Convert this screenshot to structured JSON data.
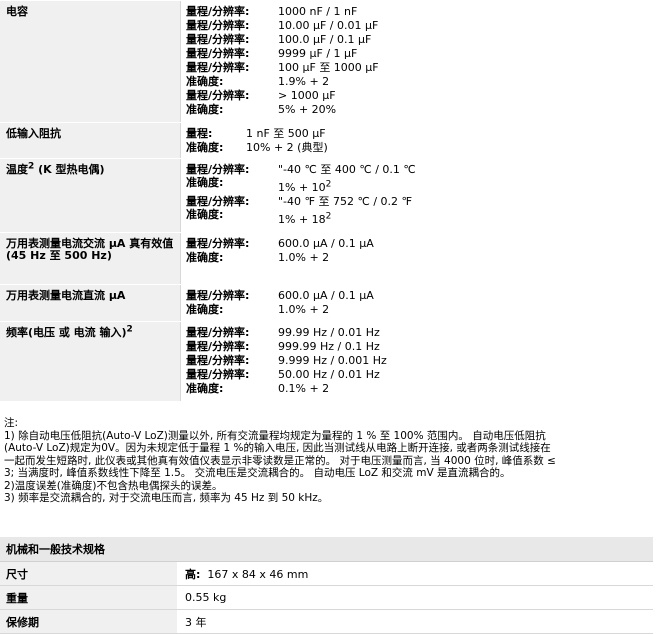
{
  "rows": [
    {
      "label": "电容",
      "lines": [
        {
          "k": "量程/分辨率:",
          "v": "1000 nF / 1 nF"
        },
        {
          "k": "量程/分辨率:",
          "v": "10.00 μF / 0.01 μF"
        },
        {
          "k": "量程/分辨率:",
          "v": "100.0 μF / 0.1 μF"
        },
        {
          "k": "量程/分辨率:",
          "v": "9999 μF / 1 μF"
        },
        {
          "k": "量程/分辨率:",
          "v": "100 μF 至 1000 μF"
        },
        {
          "k": "准确度:",
          "v": "1.9% + 2"
        },
        {
          "k": "量程/分辨率:",
          "v": "> 1000 μF"
        },
        {
          "k": "准确度:",
          "v": "5% + 20%"
        }
      ]
    },
    {
      "label": "低输入阻抗",
      "lines": [
        {
          "k": "量程:",
          "v": "1 nF 至 500 μF"
        },
        {
          "k": "准确度:",
          "v": "10% + 2 (典型)"
        }
      ]
    },
    {
      "label": "温度",
      "label_sup": "2",
      "label_suffix": "(K 型热电偶)",
      "temp_lines": [
        {
          "k": "量程/分辨率:",
          "v": "\"-40 ℃ 至 400 ℃ / 0.1 ℃"
        },
        {
          "k": "准确度:",
          "v": "1% + 10",
          "sup": "2"
        },
        {
          "k": "量程/分辨率:",
          "v": "\"-40 ℉ 至 752 ℃ / 0.2 ℉"
        },
        {
          "k": "准确度:",
          "v": "1% + 18",
          "sup": "2"
        }
      ]
    },
    {
      "label": "万用表测量电流交流 μA 真有效值(45 Hz 至 500 Hz)",
      "lines": [
        {
          "k": "量程/分辨率:",
          "v": "600.0 μA / 0.1 μA"
        },
        {
          "k": "准确度:",
          "v": "1.0% + 2"
        }
      ]
    },
    {
      "label": "万用表测量电流直流 μA",
      "lines": [
        {
          "k": "量程/分辨率:",
          "v": "600.0 μA / 0.1 μA"
        },
        {
          "k": "准确度:",
          "v": "1.0% + 2"
        }
      ]
    },
    {
      "label": "频率(电压 或 电流 输入)",
      "label_sup": "2",
      "lines": [
        {
          "k": "量程/分辨率:",
          "v": "99.99 Hz / 0.01 Hz"
        },
        {
          "k": "量程/分辨率:",
          "v": "999.99 Hz / 0.1 Hz"
        },
        {
          "k": "量程/分辨率:",
          "v": "9.999 Hz / 0.001 Hz"
        },
        {
          "k": "量程/分辨率:",
          "v": "50.00 Hz / 0.01 Hz"
        },
        {
          "k": "准确度:",
          "v": "0.1% + 2"
        }
      ]
    }
  ],
  "notes": [
    "注:",
    "1) 除自动电压低阻抗(Auto-V LoZ)测量以外, 所有交流量程均规定为量程的 1 % 至 100% 范围内。 自动电压低阻抗",
    "(Auto-V LoZ)规定为0V。因为未规定低于量程 1 %的输入电压, 因此当测试线从电路上断开连接, 或者两条测试线接在",
    "一起而发生短路时, 此仪表或其他真有效值仪表显示非零读数是正常的。 对于电压测量而言, 当 4000 位时, 峰值系数 ≤",
    "3; 当满度时, 峰值系数线性下降至 1.5。 交流电压是交流耦合的。 自动电压 LoZ 和交流 mV 是直流耦合的。",
    "2)温度误差(准确度)不包含热电偶探头的误差。",
    "3) 频率是交流耦合的, 对于交流电压而言, 频率为 45 Hz 到 50 kHz。"
  ],
  "mechanical": {
    "title": "机械和一般技术规格",
    "rows": [
      {
        "label": "尺寸",
        "key": "高:",
        "value": "167 x 84 x 46 mm"
      },
      {
        "label": "重量",
        "key": "",
        "value": "0.55 kg"
      },
      {
        "label": "保修期",
        "key": "",
        "value": "3 年"
      }
    ]
  }
}
